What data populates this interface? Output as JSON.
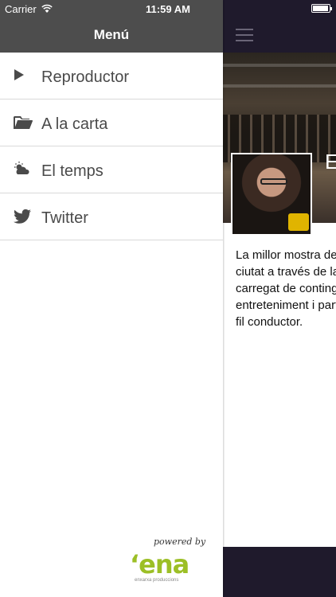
{
  "status_bar": {
    "carrier": "Carrier",
    "time": "11:59 AM"
  },
  "drawer": {
    "title": "Menú",
    "items": [
      {
        "label": "Reproductor",
        "icon": "play-icon"
      },
      {
        "label": "A la carta",
        "icon": "folder-icon"
      },
      {
        "label": "El temps",
        "icon": "weather-icon"
      },
      {
        "label": "Twitter",
        "icon": "twitter-icon"
      }
    ],
    "powered_by": "powered by",
    "logo_text": "‘ena",
    "logo_subtext": "enxarxa produccions"
  },
  "content": {
    "hero_title": "E",
    "description": "La millor mostra de\nciutat a través de la\ncarregat de contingu\nentreteniment i parti\nfil conductor."
  },
  "colors": {
    "drawer_header": "#4d4d4d",
    "nav_bar": "#1f1a2c",
    "logo_green": "#9cbf26"
  }
}
